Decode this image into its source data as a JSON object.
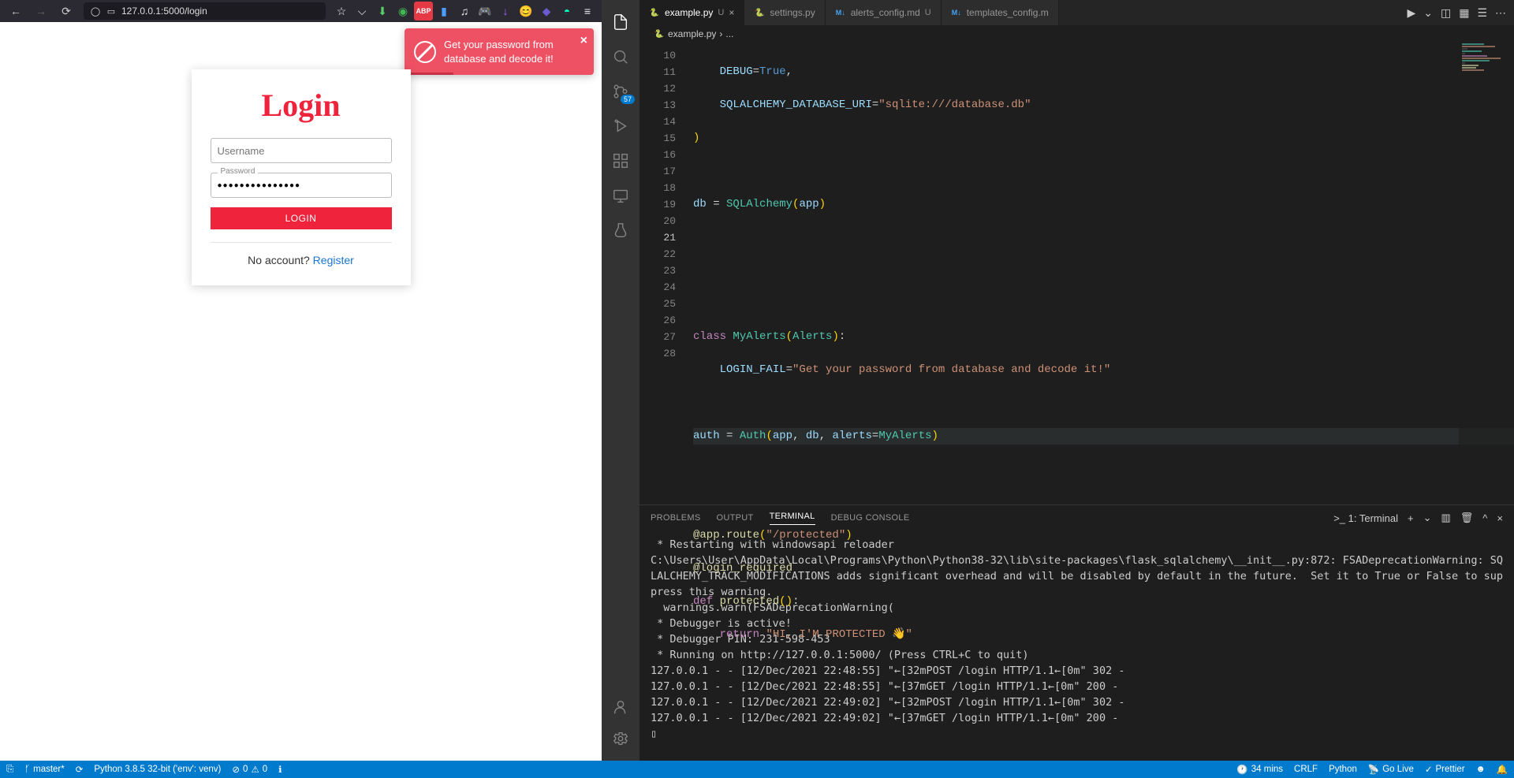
{
  "browser": {
    "url": "127.0.0.1:5000/login",
    "toolbar_icons": [
      "☆",
      "⬚",
      "⬇",
      "◉",
      "ABP",
      "▮",
      "♫",
      "🎮",
      "↓",
      "😊",
      "◆",
      "◓",
      "≡"
    ]
  },
  "toast": {
    "message": "Get your password from database and decode it!"
  },
  "login": {
    "title": "Login",
    "username_placeholder": "Username",
    "password_label": "Password",
    "password_value": "●●●●●●●●●●●●●●●",
    "button": "LOGIN",
    "no_account": "No account? ",
    "register": "Register"
  },
  "vscode": {
    "tabs": [
      {
        "name": "example.py",
        "mod": "U",
        "active": true,
        "icon": "py"
      },
      {
        "name": "settings.py",
        "mod": "",
        "active": false,
        "icon": "py"
      },
      {
        "name": "alerts_config.md",
        "mod": "U",
        "active": false,
        "icon": "md"
      },
      {
        "name": "templates_config.m",
        "mod": "",
        "active": false,
        "icon": "md"
      }
    ],
    "breadcrumb": {
      "file": "example.py",
      "rest": "..."
    },
    "activity_badge": "57",
    "line_numbers": [
      "10",
      "11",
      "12",
      "13",
      "14",
      "15",
      "16",
      "17",
      "18",
      "19",
      "20",
      "21",
      "22",
      "23",
      "24",
      "25",
      "26",
      "27",
      "28"
    ],
    "panel_tabs": [
      "PROBLEMS",
      "OUTPUT",
      "TERMINAL",
      "DEBUG CONSOLE"
    ],
    "terminal_selector": "1: Terminal",
    "terminal_output": " * Restarting with windowsapi reloader\nC:\\Users\\User\\AppData\\Local\\Programs\\Python\\Python38-32\\lib\\site-packages\\flask_sqlalchemy\\__init__.py:872: FSADeprecationWarning: SQLALCHEMY_TRACK_MODIFICATIONS adds significant overhead and will be disabled by default in the future.  Set it to True or False to suppress this warning.\n  warnings.warn(FSADeprecationWarning(\n * Debugger is active!\n * Debugger PIN: 231-598-453\n * Running on http://127.0.0.1:5000/ (Press CTRL+C to quit)\n127.0.0.1 - - [12/Dec/2021 22:48:55] \"←[32mPOST /login HTTP/1.1←[0m\" 302 -\n127.0.0.1 - - [12/Dec/2021 22:48:55] \"←[37mGET /login HTTP/1.1←[0m\" 200 -\n127.0.0.1 - - [12/Dec/2021 22:49:02] \"←[32mPOST /login HTTP/1.1←[0m\" 302 -\n127.0.0.1 - - [12/Dec/2021 22:49:02] \"←[37mGET /login HTTP/1.1←[0m\" 200 -\n▯"
  },
  "statusbar": {
    "branch": "master*",
    "python": "Python 3.8.5 32-bit ('env': venv)",
    "errors": "0",
    "warnings": "0",
    "time": "34 mins",
    "eol": "CRLF",
    "lang": "Python",
    "golive": "Go Live",
    "formatter": "Prettier"
  }
}
